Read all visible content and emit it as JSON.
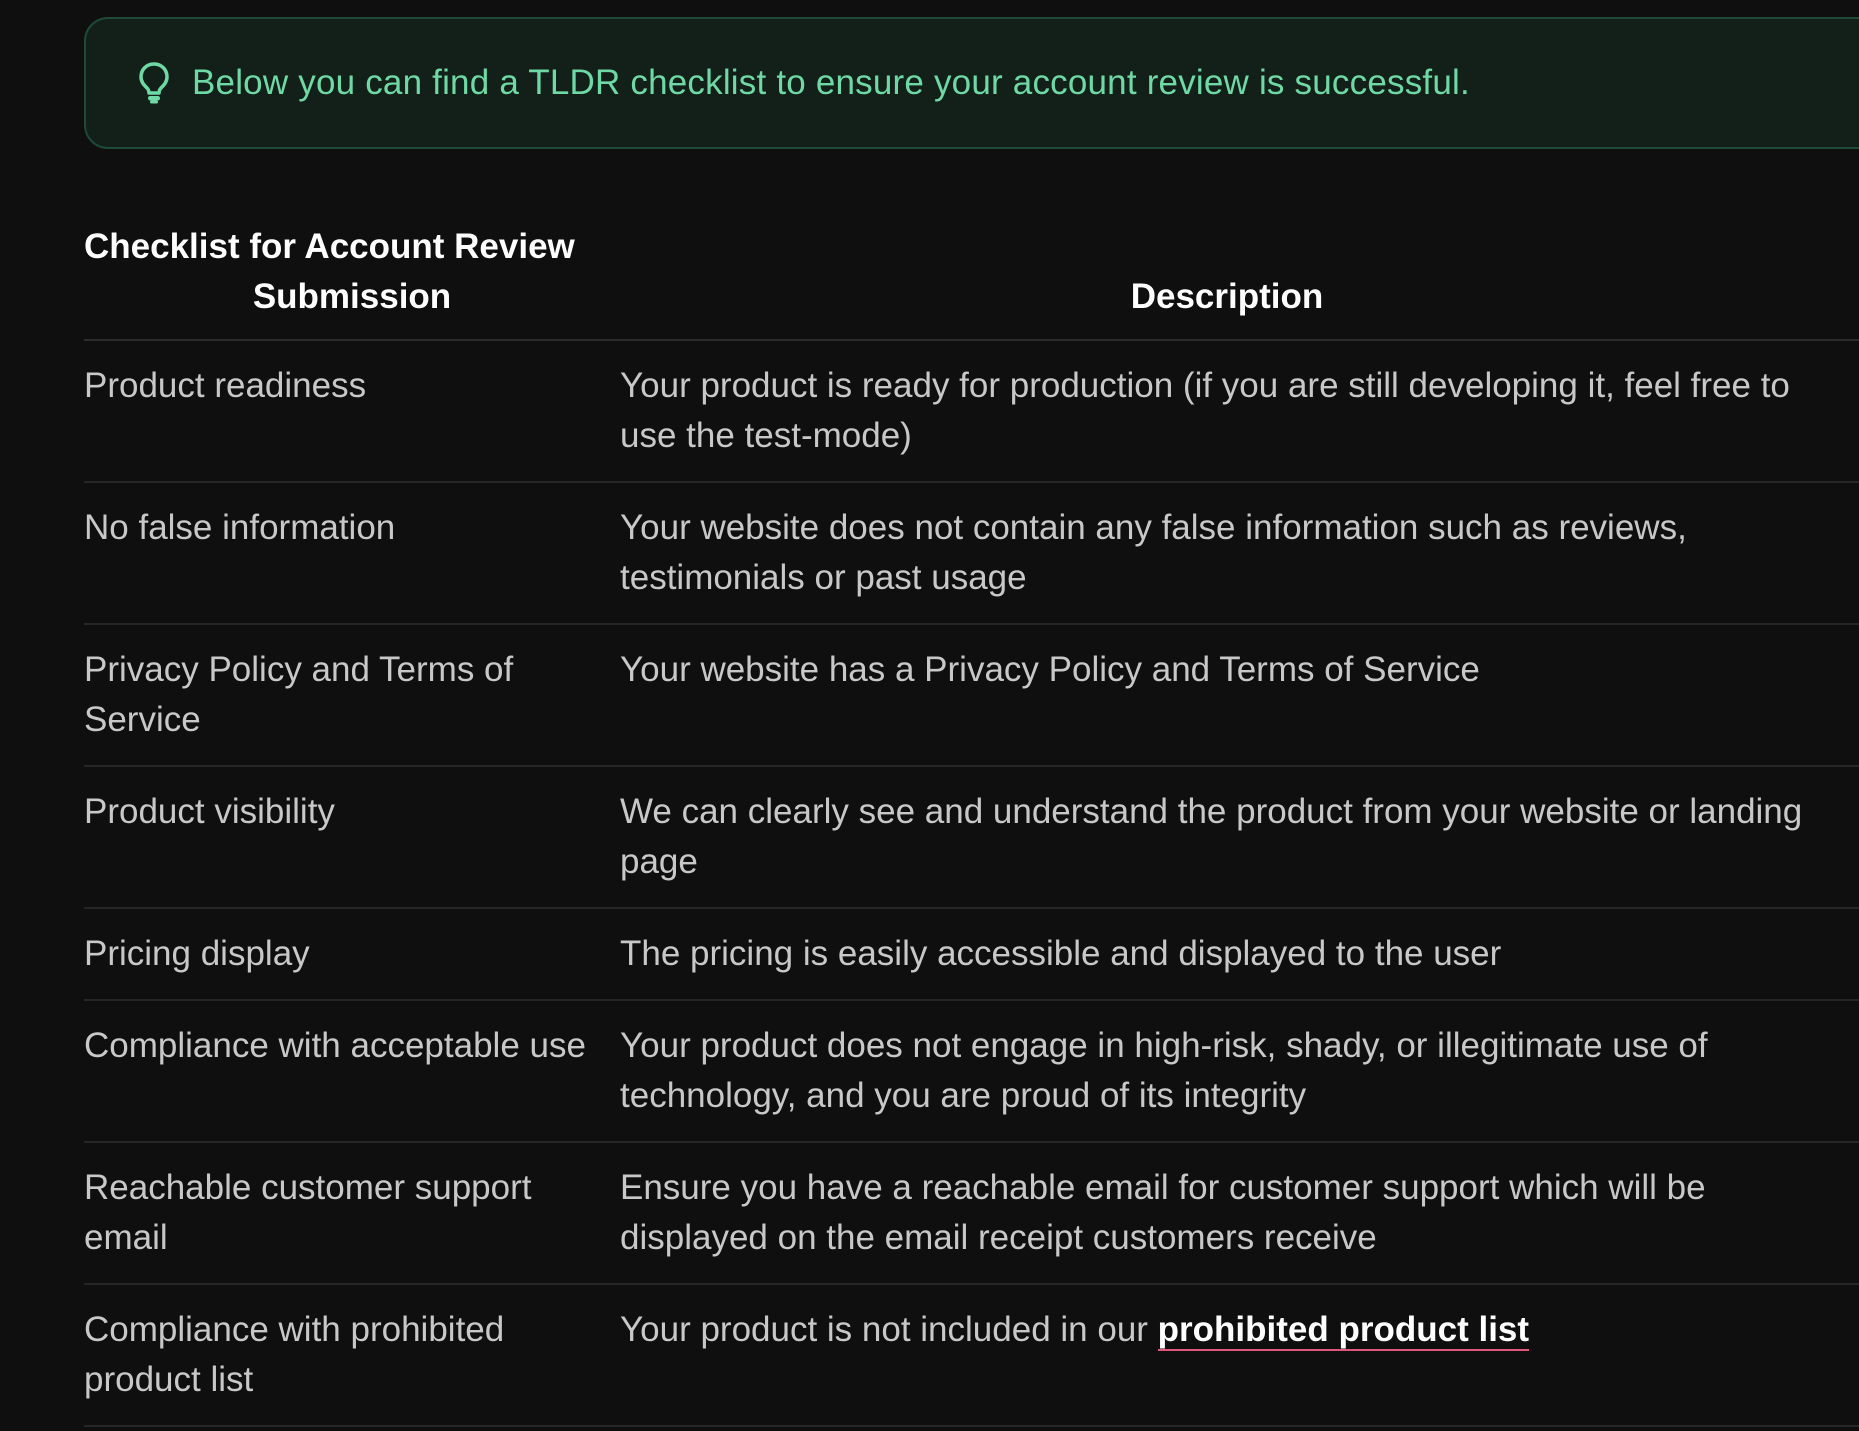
{
  "callout": {
    "icon": "lightbulb-icon",
    "text": "Below you can find a TLDR checklist to ensure your account review is successful.",
    "color": "#6fd9a5"
  },
  "table": {
    "headers": {
      "col1_line1": "Checklist for Account Review",
      "col1_line2": "Submission",
      "col2": "Description"
    },
    "rows": [
      {
        "item": "Product readiness",
        "description": "Your product is ready for production (if you are still developing it, feel free to use the test-mode)"
      },
      {
        "item": "No false information",
        "description": "Your website does not contain any false information such as reviews, testimonials or past usage"
      },
      {
        "item": "Privacy Policy and Terms of Service",
        "description": "Your website has a Privacy Policy and Terms of Service"
      },
      {
        "item": "Product visibility",
        "description": "We can clearly see and understand the product from your website or landing page"
      },
      {
        "item": "Pricing display",
        "description": "The pricing is easily accessible and displayed to the user"
      },
      {
        "item": "Compliance with acceptable use",
        "description": "Your product does not engage in high-risk, shady, or illegitimate use of technology, and you are proud of its integrity"
      },
      {
        "item": "Reachable customer support email",
        "description": "Ensure you have a reachable email for customer support which will be displayed on the email receipt customers receive"
      },
      {
        "item": "Compliance with prohibited product list",
        "description_prefix": "Your product is not included in our ",
        "link_text": "prohibited product list"
      }
    ]
  }
}
